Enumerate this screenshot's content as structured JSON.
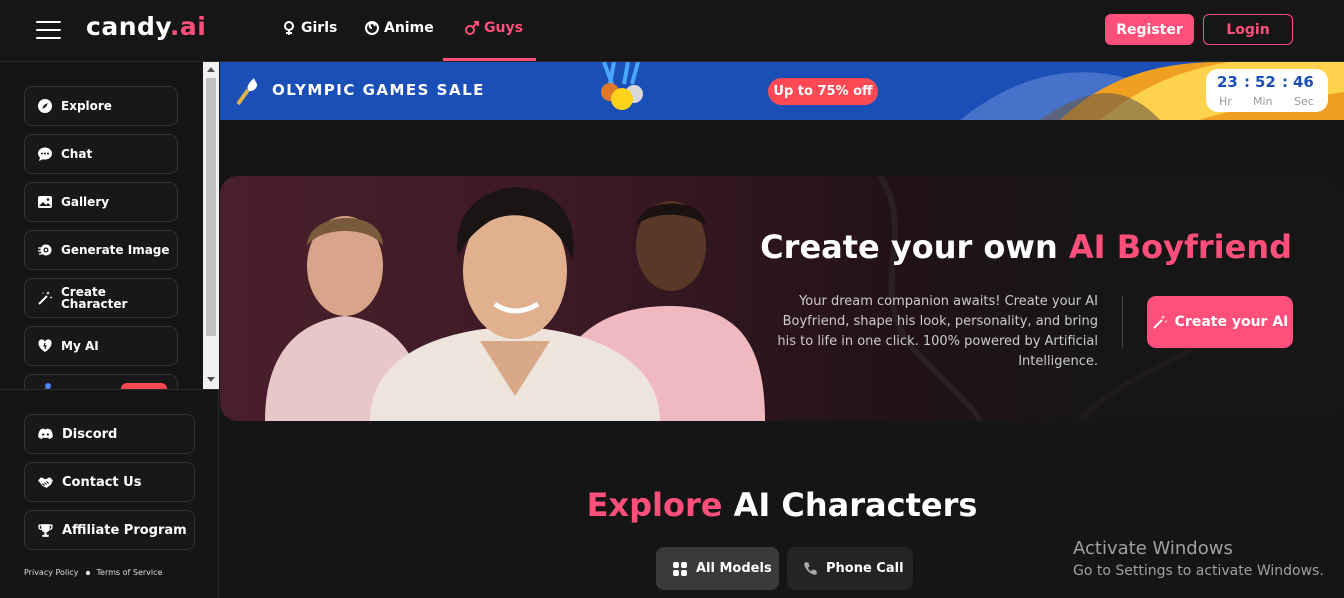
{
  "header": {
    "logo_text": "candy",
    "logo_suffix": ".ai",
    "tabs": [
      {
        "label": "Girls",
        "icon": "female-icon"
      },
      {
        "label": "Anime",
        "icon": "swirl-icon"
      },
      {
        "label": "Guys",
        "icon": "male-icon",
        "active": true
      }
    ],
    "register_label": "Register",
    "login_label": "Login"
  },
  "sidebar": {
    "items": [
      {
        "label": "Explore",
        "icon": "compass-icon"
      },
      {
        "label": "Chat",
        "icon": "chat-icon"
      },
      {
        "label": "Gallery",
        "icon": "image-icon"
      },
      {
        "label": "Generate Image",
        "icon": "camera-icon"
      },
      {
        "label": "Create",
        "label2": "Character",
        "icon": "magic-wand-icon"
      },
      {
        "label": "My AI",
        "icon": "heart-icon"
      }
    ],
    "bottom_items": [
      {
        "label": "Discord",
        "icon": "discord-icon"
      },
      {
        "label": "Contact Us",
        "icon": "handshake-icon"
      },
      {
        "label": "Affiliate Program",
        "icon": "trophy-icon"
      }
    ],
    "privacy_label": "Privacy Policy",
    "terms_label": "Terms of Service"
  },
  "banner": {
    "title": "OLYMPIC GAMES SALE",
    "discount": "Up to 75% off",
    "timer": {
      "hours": "23",
      "minutes": "52",
      "seconds": "46",
      "hours_label": "Hr",
      "minutes_label": "Min",
      "seconds_label": "Sec",
      "separator": ":"
    }
  },
  "hero": {
    "title_plain": "Create your own ",
    "title_highlight": "AI Boyfriend",
    "description": "Your dream companion awaits! Create your AI Boyfriend, shape his look, personality, and bring his to life in one click. 100% powered by Artificial Intelligence.",
    "cta_label": "Create your AI"
  },
  "explore": {
    "title_highlight": "Explore",
    "title_plain": " AI Characters",
    "filters": [
      {
        "label": "All Models",
        "icon": "grid-icon",
        "active": true
      },
      {
        "label": "Phone Call",
        "icon": "phone-icon",
        "active": false
      }
    ]
  },
  "watermark": {
    "line1": "Activate Windows",
    "line2": "Go to Settings to activate Windows."
  },
  "colors": {
    "accent": "#ff4f7a",
    "banner_blue": "#1b4fb8",
    "background": "#151515"
  }
}
